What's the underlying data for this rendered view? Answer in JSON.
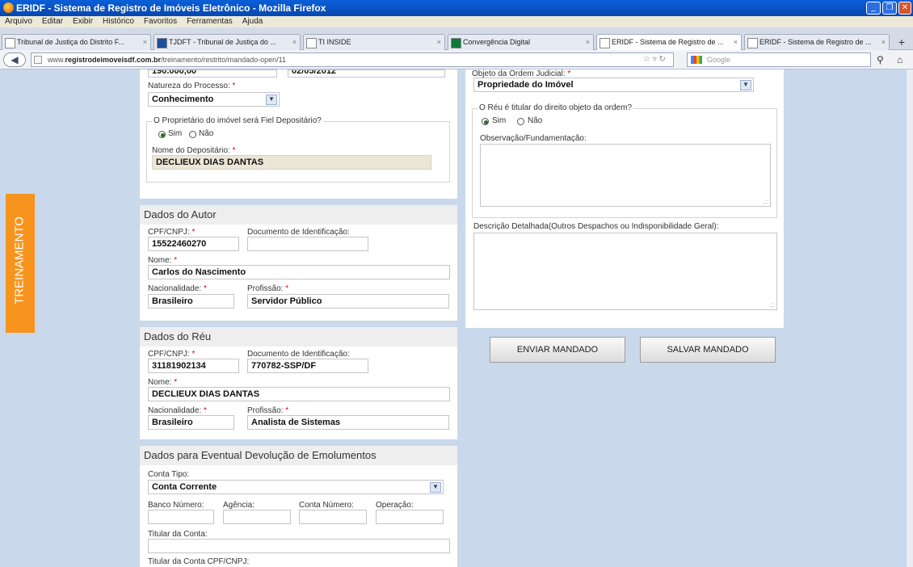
{
  "window": {
    "title": "ERIDF - Sistema de Registro de Imóveis Eletrônico - Mozilla Firefox"
  },
  "menu": [
    "Arquivo",
    "Editar",
    "Exibir",
    "Histórico",
    "Favoritos",
    "Ferramentas",
    "Ajuda"
  ],
  "tabs": [
    {
      "label": "Tribunal de Justiça do Distrito F..."
    },
    {
      "label": "TJDFT - Tribunal de Justiça do ..."
    },
    {
      "label": "TI INSIDE"
    },
    {
      "label": "Convergência Digital"
    },
    {
      "label": "ERIDF - Sistema de Registro de ..."
    },
    {
      "label": "ERIDF - Sistema de Registro de ..."
    }
  ],
  "nav": {
    "url_prefix": "www.",
    "url_host": "registrodeimoveisdf.com.br",
    "url_path": "/treinamento/restrito/mandado-open/11",
    "search_placeholder": "Google"
  },
  "badge": "TREINAMENTO",
  "processo": {
    "top_left_value": "190.000,00",
    "top_right_value": "02/05/2012",
    "natureza_label": "Natureza do Processo:",
    "natureza_value": "Conhecimento",
    "fiel_legend": "O Proprietário do imóvel será Fiel Depositário?",
    "sim": "Sim",
    "nao": "Não",
    "depositario_label": "Nome do Depositário:",
    "depositario_value": "DECLIEUX DIAS DANTAS"
  },
  "autor": {
    "heading": "Dados do Autor",
    "cpf_label": "CPF/CNPJ:",
    "cpf_value": "15522460270",
    "doc_label": "Documento de Identificação:",
    "doc_value": "",
    "nome_label": "Nome:",
    "nome_value": "Carlos do Nascimento",
    "nac_label": "Nacionalidade:",
    "nac_value": "Brasileiro",
    "prof_label": "Profissão:",
    "prof_value": "Servidor Público"
  },
  "reu": {
    "heading": "Dados do Réu",
    "cpf_label": "CPF/CNPJ:",
    "cpf_value": "31181902134",
    "doc_label": "Documento de Identificação:",
    "doc_value": "770782-SSP/DF",
    "nome_label": "Nome:",
    "nome_value": "DECLIEUX DIAS DANTAS",
    "nac_label": "Nacionalidade:",
    "nac_value": "Brasileiro",
    "prof_label": "Profissão:",
    "prof_value": "Analista de Sistemas"
  },
  "devolucao": {
    "heading": "Dados para Eventual Devolução de Emolumentos",
    "conta_tipo_label": "Conta Tipo:",
    "conta_tipo_value": "Conta Corrente",
    "banco_label": "Banco Número:",
    "agencia_label": "Agência:",
    "conta_label": "Conta Número:",
    "operacao_label": "Operação:",
    "titular_label": "Titular da Conta:",
    "titular_cpf_label": "Titular da Conta CPF/CNPJ:"
  },
  "ordem": {
    "objeto_label": "Objeto da Ordem Judicial:",
    "objeto_value": "Propriedade do Imóvel",
    "reu_titular_legend": "O Réu é titular do direito objeto da ordem?",
    "sim": "Sim",
    "nao": "Não",
    "obs_label": "Observação/Fundamentação:",
    "descricao_label": "Descrição Detalhada(Outros Despachos ou Indisponibilidade Geral):"
  },
  "buttons": {
    "enviar": "ENVIAR MANDADO",
    "salvar": "SALVAR MANDADO"
  }
}
